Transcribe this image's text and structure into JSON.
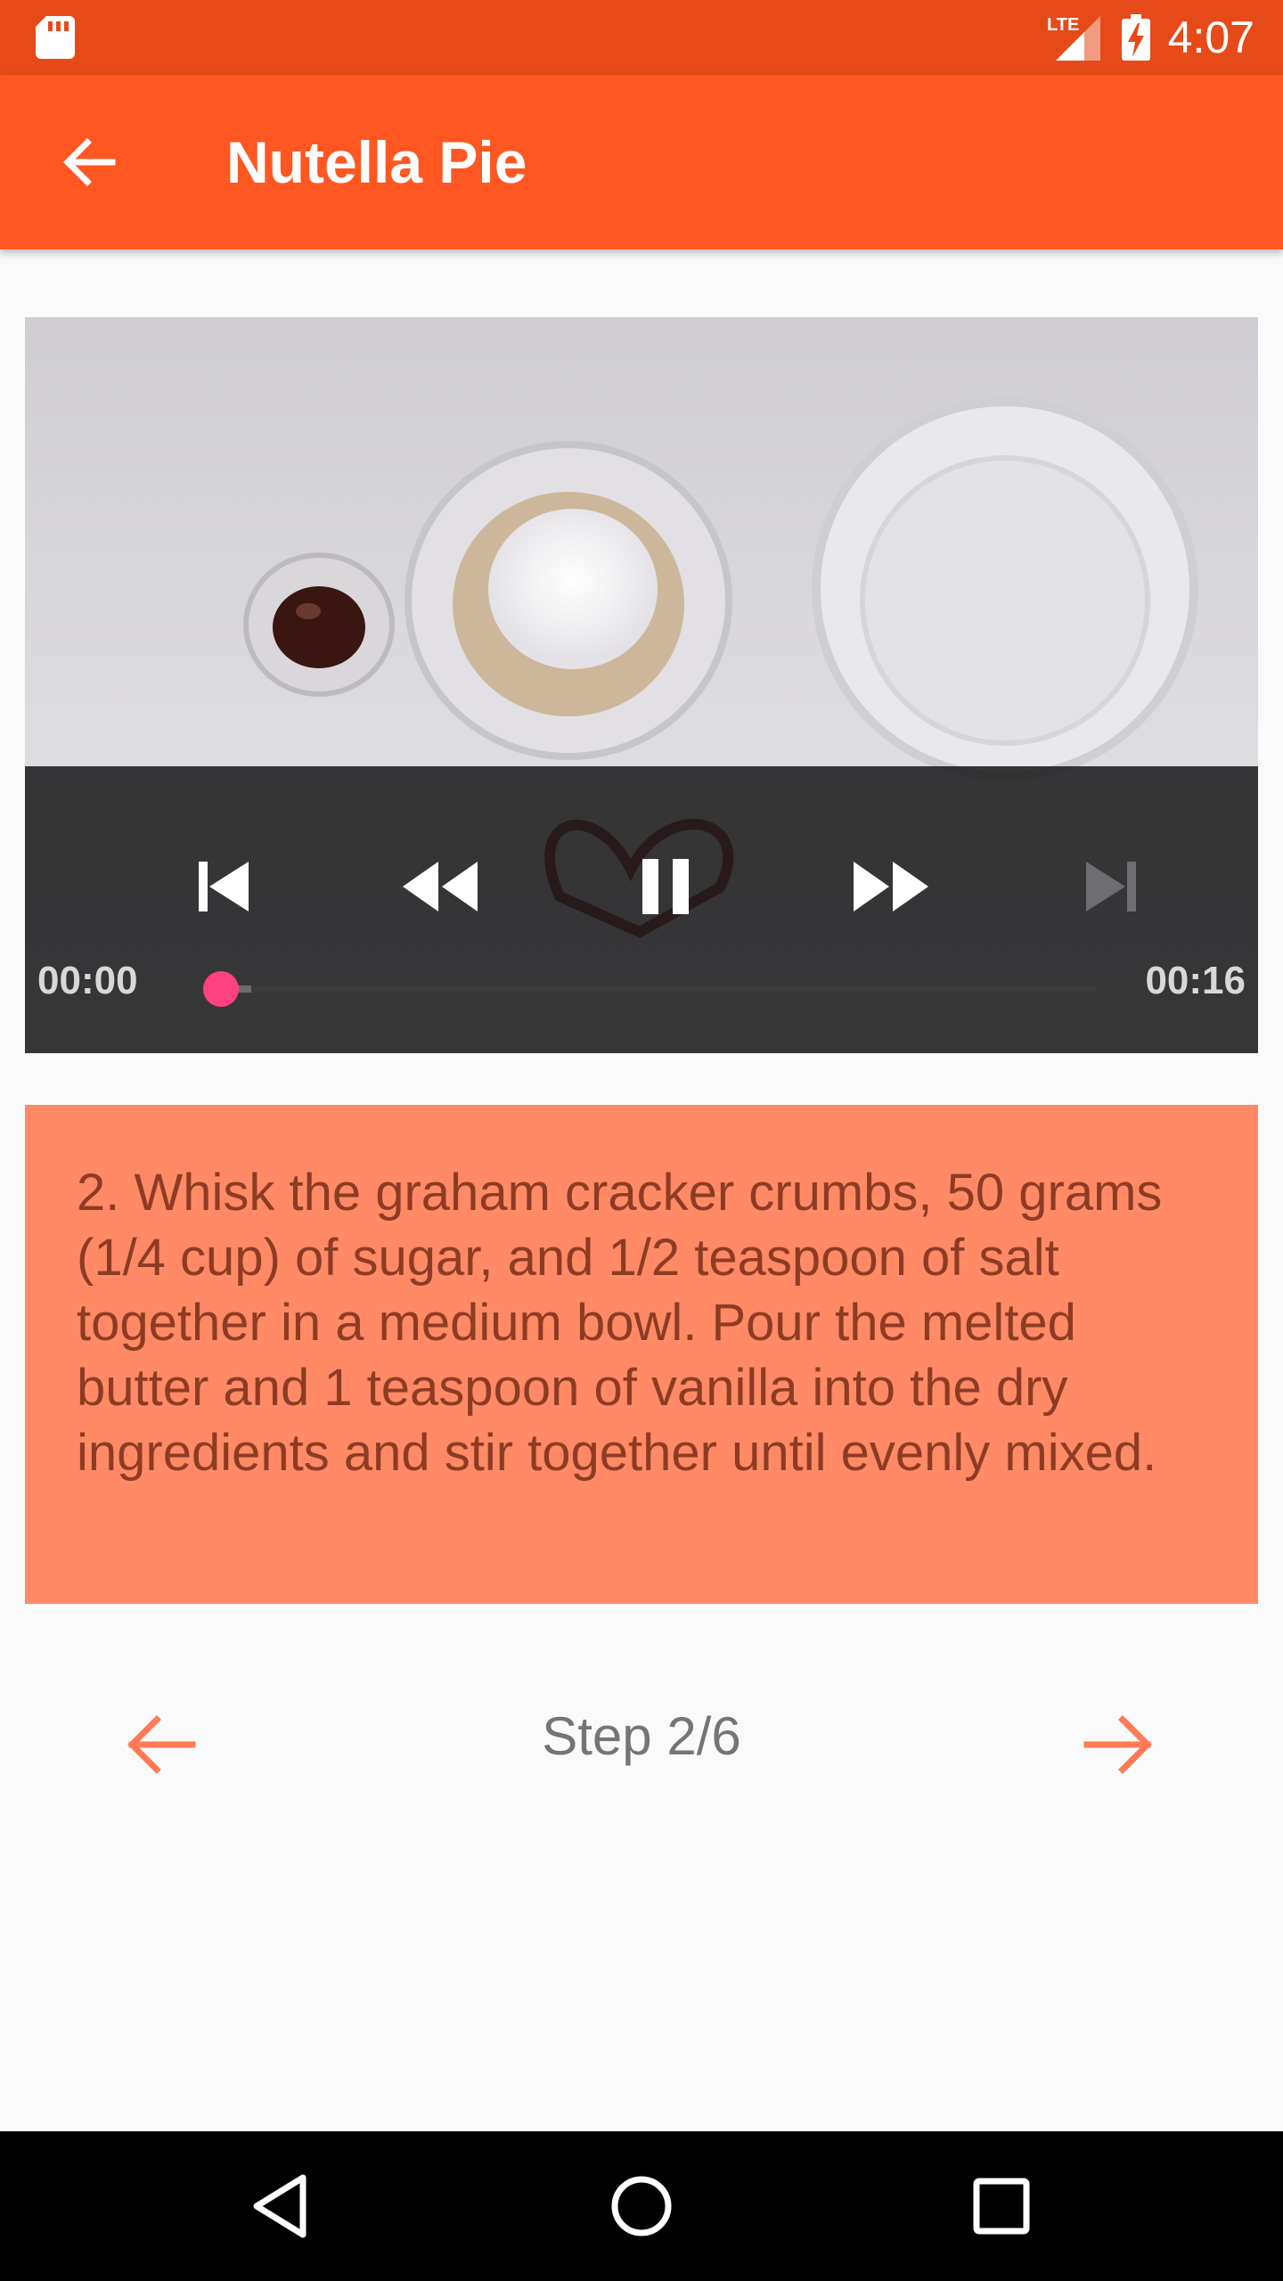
{
  "status_bar": {
    "network": "LTE",
    "time": "4:07"
  },
  "app_bar": {
    "title": "Nutella Pie",
    "back_icon": "arrow-back-icon"
  },
  "player": {
    "time_current": "00:00",
    "time_total": "00:16",
    "progress": 0.0,
    "buffered": 0.04,
    "icons": [
      "skip-previous-icon",
      "rewind-icon",
      "pause-icon",
      "fast-forward-icon",
      "skip-next-icon"
    ]
  },
  "step": {
    "description": "2. Whisk the graham cracker crumbs, 50 grams (1/4 cup) of sugar, and 1/2 teaspoon of salt together in a medium bowl. Pour the melted butter and 1 teaspoon of vanilla into the dry ingredients and stir together until evenly mixed.",
    "label": "Step 2/6"
  },
  "colors": {
    "status_bar": "#e64a19",
    "app_bar": "#ff5722",
    "step_card": "#ff8a65",
    "step_text": "#8d3c24",
    "nav_arrow": "#ff7a55",
    "seek_thumb": "#ff4081"
  }
}
